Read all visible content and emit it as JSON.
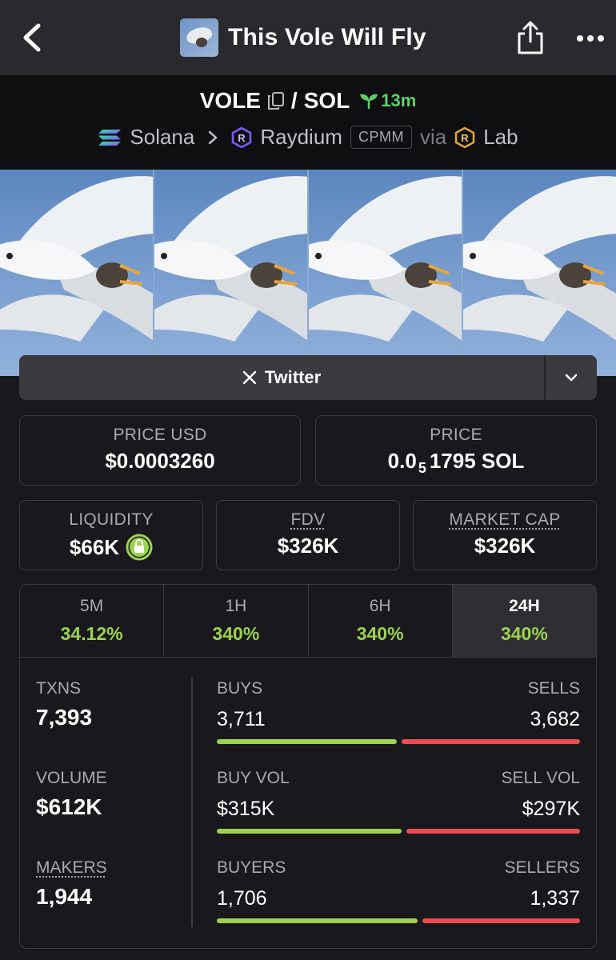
{
  "app": {
    "title": "This Vole Will Fly"
  },
  "pair": {
    "base": "VOLE",
    "quote": "SOL",
    "separator": "/",
    "age": "13m",
    "chain": "Solana",
    "dex": "Raydium",
    "pool_type": "CPMM",
    "via_label": "via",
    "via": "Lab"
  },
  "links": {
    "twitter_label": "Twitter"
  },
  "price": {
    "usd_label": "PRICE USD",
    "usd_value": "$0.0003260",
    "native_label": "PRICE",
    "native_prefix": "0.0",
    "native_zeros": "5",
    "native_digits": "1795 SOL"
  },
  "metrics": {
    "liquidity_label": "LIQUIDITY",
    "liquidity_value": "$66K",
    "fdv_label": "FDV",
    "fdv_value": "$326K",
    "mcap_label": "MARKET CAP",
    "mcap_value": "$326K"
  },
  "timeframes": [
    {
      "label": "5M",
      "value": "34.12%"
    },
    {
      "label": "1H",
      "value": "340%"
    },
    {
      "label": "6H",
      "value": "340%"
    },
    {
      "label": "24H",
      "value": "340%",
      "active": true
    }
  ],
  "stats": {
    "txns_label": "TXNS",
    "txns_value": "7,393",
    "volume_label": "VOLUME",
    "volume_value": "$612K",
    "makers_label": "MAKERS",
    "makers_value": "1,944",
    "buys_label": "BUYS",
    "buys_value": "3,711",
    "sells_label": "SELLS",
    "sells_value": "3,682",
    "buy_vol_label": "BUY VOL",
    "buy_vol_value": "$315K",
    "sell_vol_label": "SELL VOL",
    "sell_vol_value": "$297K",
    "buyers_label": "BUYERS",
    "buyers_value": "1,706",
    "sellers_label": "SELLERS",
    "sellers_value": "1,337",
    "buys_ratio": 0.502,
    "buy_vol_ratio": 0.515,
    "buyers_ratio": 0.561
  },
  "colors": {
    "green": "#9dd24f",
    "red": "#ee4c4f",
    "age": "#5fd068"
  }
}
